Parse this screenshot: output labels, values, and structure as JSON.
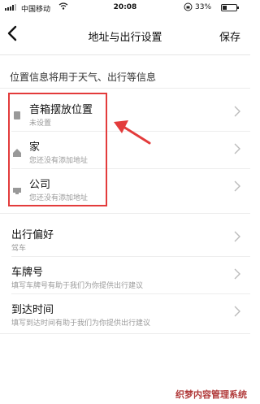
{
  "status_bar": {
    "carrier": "中国移动",
    "time": "20:08",
    "battery_pct": "33%",
    "battery_level": 0.33
  },
  "nav": {
    "title": "地址与出行设置",
    "save_label": "保存",
    "back_icon": "chevron-left-icon"
  },
  "info_text": "位置信息将用于天气、出行等信息",
  "location_items": [
    {
      "label": "音箱摆放位置",
      "sub": "未设置",
      "icon": "speaker-icon"
    },
    {
      "label": "家",
      "sub": "您还没有添加地址",
      "icon": "home-icon"
    },
    {
      "label": "公司",
      "sub": "您还没有添加地址",
      "icon": "office-icon"
    }
  ],
  "travel_items": [
    {
      "label": "出行偏好",
      "sub": "驾车"
    },
    {
      "label": "车牌号",
      "sub": "填写车牌号有助于我们为你提供出行建议"
    },
    {
      "label": "到达时间",
      "sub": "填写到达时间有助于我们为你提供出行建议"
    }
  ],
  "watermark": "织梦内容管理系统",
  "colors": {
    "highlight": "#e33b3b",
    "chevron": "#bbbbbb",
    "subtext": "#9a9a9a"
  }
}
